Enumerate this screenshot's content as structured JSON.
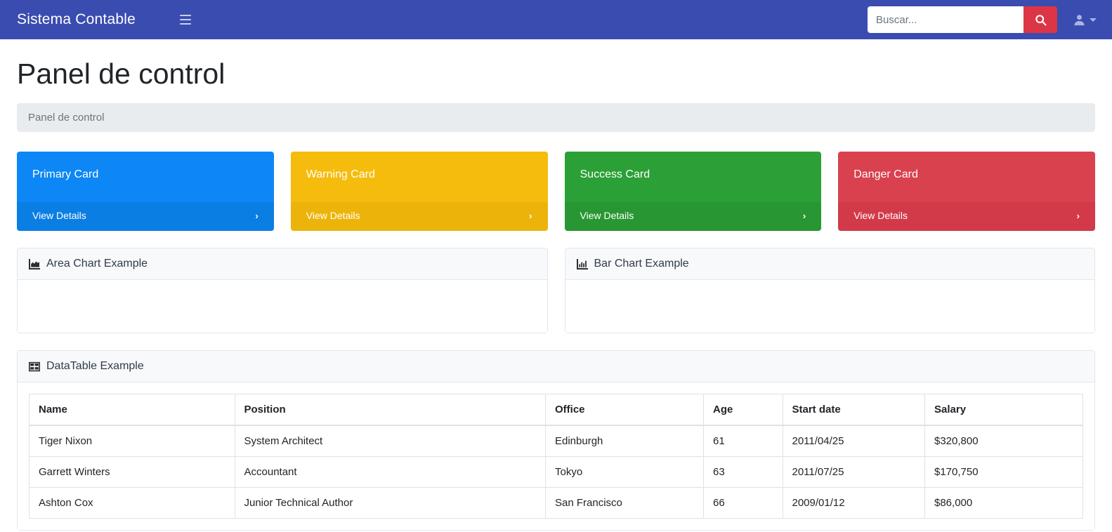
{
  "navbar": {
    "brand": "Sistema Contable",
    "menu_icon": "hamburger-icon",
    "search": {
      "placeholder": "Buscar...",
      "value": "",
      "button_icon": "search-icon"
    },
    "user_icon": "user-icon",
    "brand_bg": "#3b4cb0",
    "search_btn_bg": "#dc3545"
  },
  "page": {
    "title": "Panel de control",
    "breadcrumb": "Panel de control"
  },
  "cards": [
    {
      "title": "Primary Card",
      "link": "View Details",
      "chevron": "›",
      "variant": "primary",
      "color": "#0d87f5"
    },
    {
      "title": "Warning Card",
      "link": "View Details",
      "chevron": "›",
      "variant": "warning",
      "color": "#f5bc0d"
    },
    {
      "title": "Success Card",
      "link": "View Details",
      "chevron": "›",
      "variant": "success",
      "color": "#2ba036"
    },
    {
      "title": "Danger Card",
      "link": "View Details",
      "chevron": "›",
      "variant": "danger",
      "color": "#d9414f"
    }
  ],
  "panels": {
    "area_chart": {
      "title": "Area Chart Example",
      "icon": "area-chart-icon"
    },
    "bar_chart": {
      "title": "Bar Chart Example",
      "icon": "bar-chart-icon"
    },
    "datatable": {
      "title": "DataTable Example",
      "icon": "table-icon"
    }
  },
  "chart_data": [
    {
      "type": "area",
      "title": "Area Chart Example",
      "categories": [],
      "values": [],
      "xlabel": "",
      "ylabel": "",
      "rendered": false
    },
    {
      "type": "bar",
      "title": "Bar Chart Example",
      "categories": [],
      "values": [],
      "xlabel": "",
      "ylabel": "",
      "rendered": false
    }
  ],
  "table": {
    "columns": [
      "Name",
      "Position",
      "Office",
      "Age",
      "Start date",
      "Salary"
    ],
    "rows": [
      {
        "name": "Tiger Nixon",
        "position": "System Architect",
        "office": "Edinburgh",
        "age": "61",
        "start": "2011/04/25",
        "salary": "$320,800"
      },
      {
        "name": "Garrett Winters",
        "position": "Accountant",
        "office": "Tokyo",
        "age": "63",
        "start": "2011/07/25",
        "salary": "$170,750"
      },
      {
        "name": "Ashton Cox",
        "position": "Junior Technical Author",
        "office": "San Francisco",
        "age": "66",
        "start": "2009/01/12",
        "salary": "$86,000"
      }
    ]
  }
}
